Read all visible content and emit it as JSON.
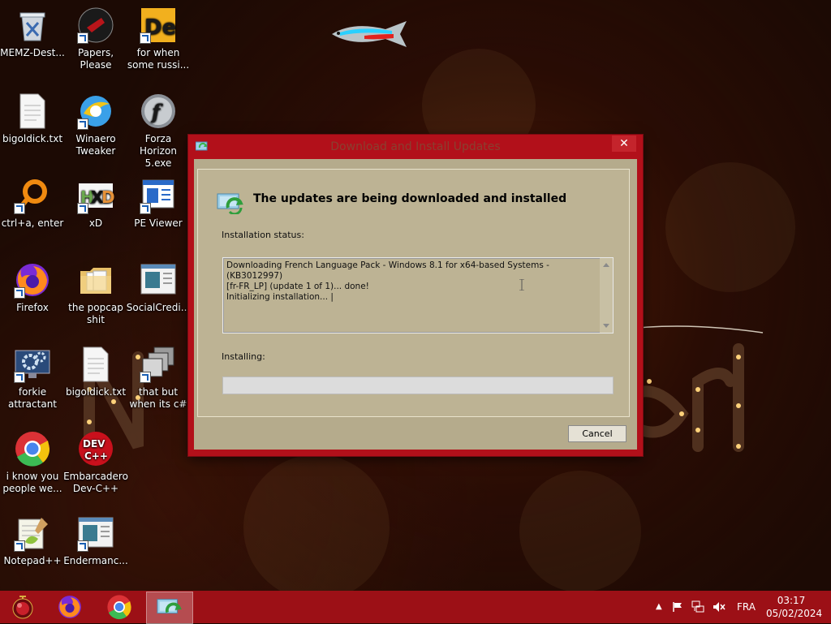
{
  "desktop": {
    "icons": [
      {
        "label": "MEMZ-Dest...",
        "icon": "recycle-bin-icon"
      },
      {
        "label": "Papers, Please",
        "icon": "papers-please-icon"
      },
      {
        "label": "for when some russi...",
        "icon": "de-icon"
      },
      {
        "label": "bigoldick.txt",
        "icon": "text-file-icon"
      },
      {
        "label": "Winaero Tweaker",
        "icon": "winaero-icon"
      },
      {
        "label": "Forza Horizon 5.exe",
        "icon": "flash-icon"
      },
      {
        "label": "ctrl+a, enter",
        "icon": "orange-ring-icon"
      },
      {
        "label": "xD",
        "icon": "hxd-icon"
      },
      {
        "label": "PE Viewer",
        "icon": "pe-viewer-icon"
      },
      {
        "label": "Firefox",
        "icon": "firefox-icon"
      },
      {
        "label": "the popcap shit",
        "icon": "folder-icon"
      },
      {
        "label": "SocialCredi...",
        "icon": "app-window-icon"
      },
      {
        "label": "forkie attractant",
        "icon": "gear-monitor-icon"
      },
      {
        "label": "bigoldick.txt",
        "icon": "text-file-icon"
      },
      {
        "label": "that but when its c#",
        "icon": "stacked-windows-icon"
      },
      {
        "label": "i know you people we...",
        "icon": "chrome-icon"
      },
      {
        "label": "Embarcadero Dev-C++",
        "icon": "devcpp-icon"
      },
      {
        "label": "Notepad++",
        "icon": "notepadpp-icon"
      },
      {
        "label": "Endermanc...",
        "icon": "app-window-icon"
      }
    ]
  },
  "dialog": {
    "title": "Download and Install Updates",
    "close_glyph": "✕",
    "heading": "The updates are being downloaded and installed",
    "status_label": "Installation status:",
    "status_text": "Downloading French Language Pack - Windows 8.1 for x64-based Systems - (KB3012997)\n[fr-FR_LP] (update 1 of 1)... done!\nInitializing installation... |",
    "installing_label": "Installing:",
    "progress_percent": 0,
    "cancel_label": "Cancel"
  },
  "taskbar": {
    "apps": [
      {
        "name": "start-button",
        "icon": "start-orb-icon"
      },
      {
        "name": "firefox",
        "icon": "firefox-icon"
      },
      {
        "name": "chrome",
        "icon": "chrome-icon"
      },
      {
        "name": "windows-update",
        "icon": "update-icon",
        "active": true
      }
    ],
    "tray": {
      "chevron": "▲",
      "language": "FRA",
      "time": "03:17",
      "date": "05/02/2024"
    }
  },
  "colors": {
    "dialog_frame": "#b2101a",
    "taskbar": "#9c1016",
    "client": "#b5ab8c"
  }
}
